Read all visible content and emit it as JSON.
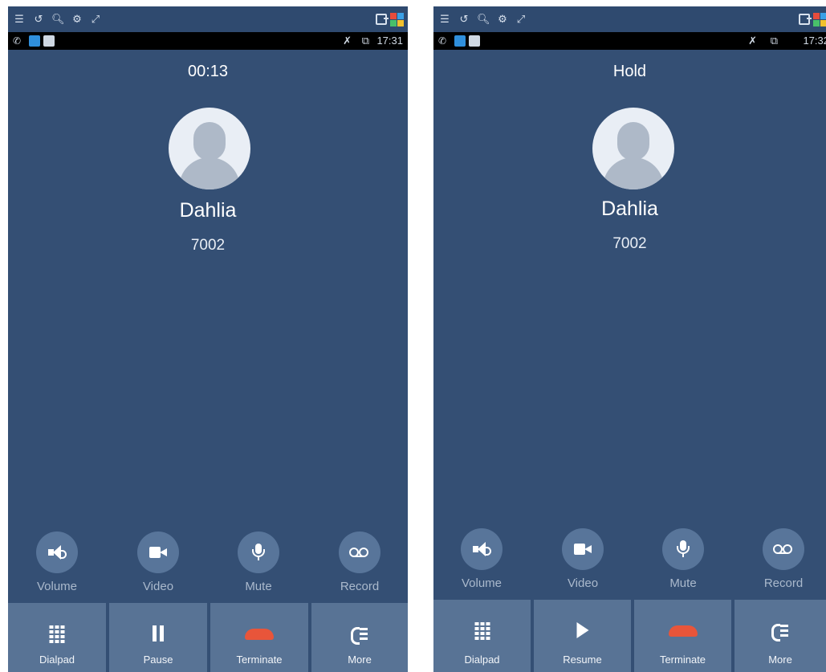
{
  "left_screen": {
    "sys_icons": [
      "menu-icon",
      "refresh-icon",
      "search-icon",
      "settings-icon",
      "expand-icon"
    ],
    "status_time": "17:31",
    "call_state": "00:13",
    "contact_name": "Dahlia",
    "contact_number": "7002",
    "actions": [
      "Volume",
      "Video",
      "Mute",
      "Record"
    ],
    "tabs": [
      "Dialpad",
      "Pause",
      "Terminate",
      "More"
    ]
  },
  "right_screen": {
    "sys_icons": [
      "menu-icon",
      "refresh-icon",
      "search-icon",
      "settings-icon",
      "expand-icon"
    ],
    "status_time": "17:32",
    "call_state": "Hold",
    "contact_name": "Dahlia",
    "contact_number": "7002",
    "actions": [
      "Volume",
      "Video",
      "Mute",
      "Record"
    ],
    "tabs": [
      "Dialpad",
      "Resume",
      "Terminate",
      "More"
    ]
  },
  "colors": {
    "background": "#344f74",
    "action_circle": "#58759a",
    "tab_background": "#587395",
    "terminate_red": "#e8553a"
  }
}
